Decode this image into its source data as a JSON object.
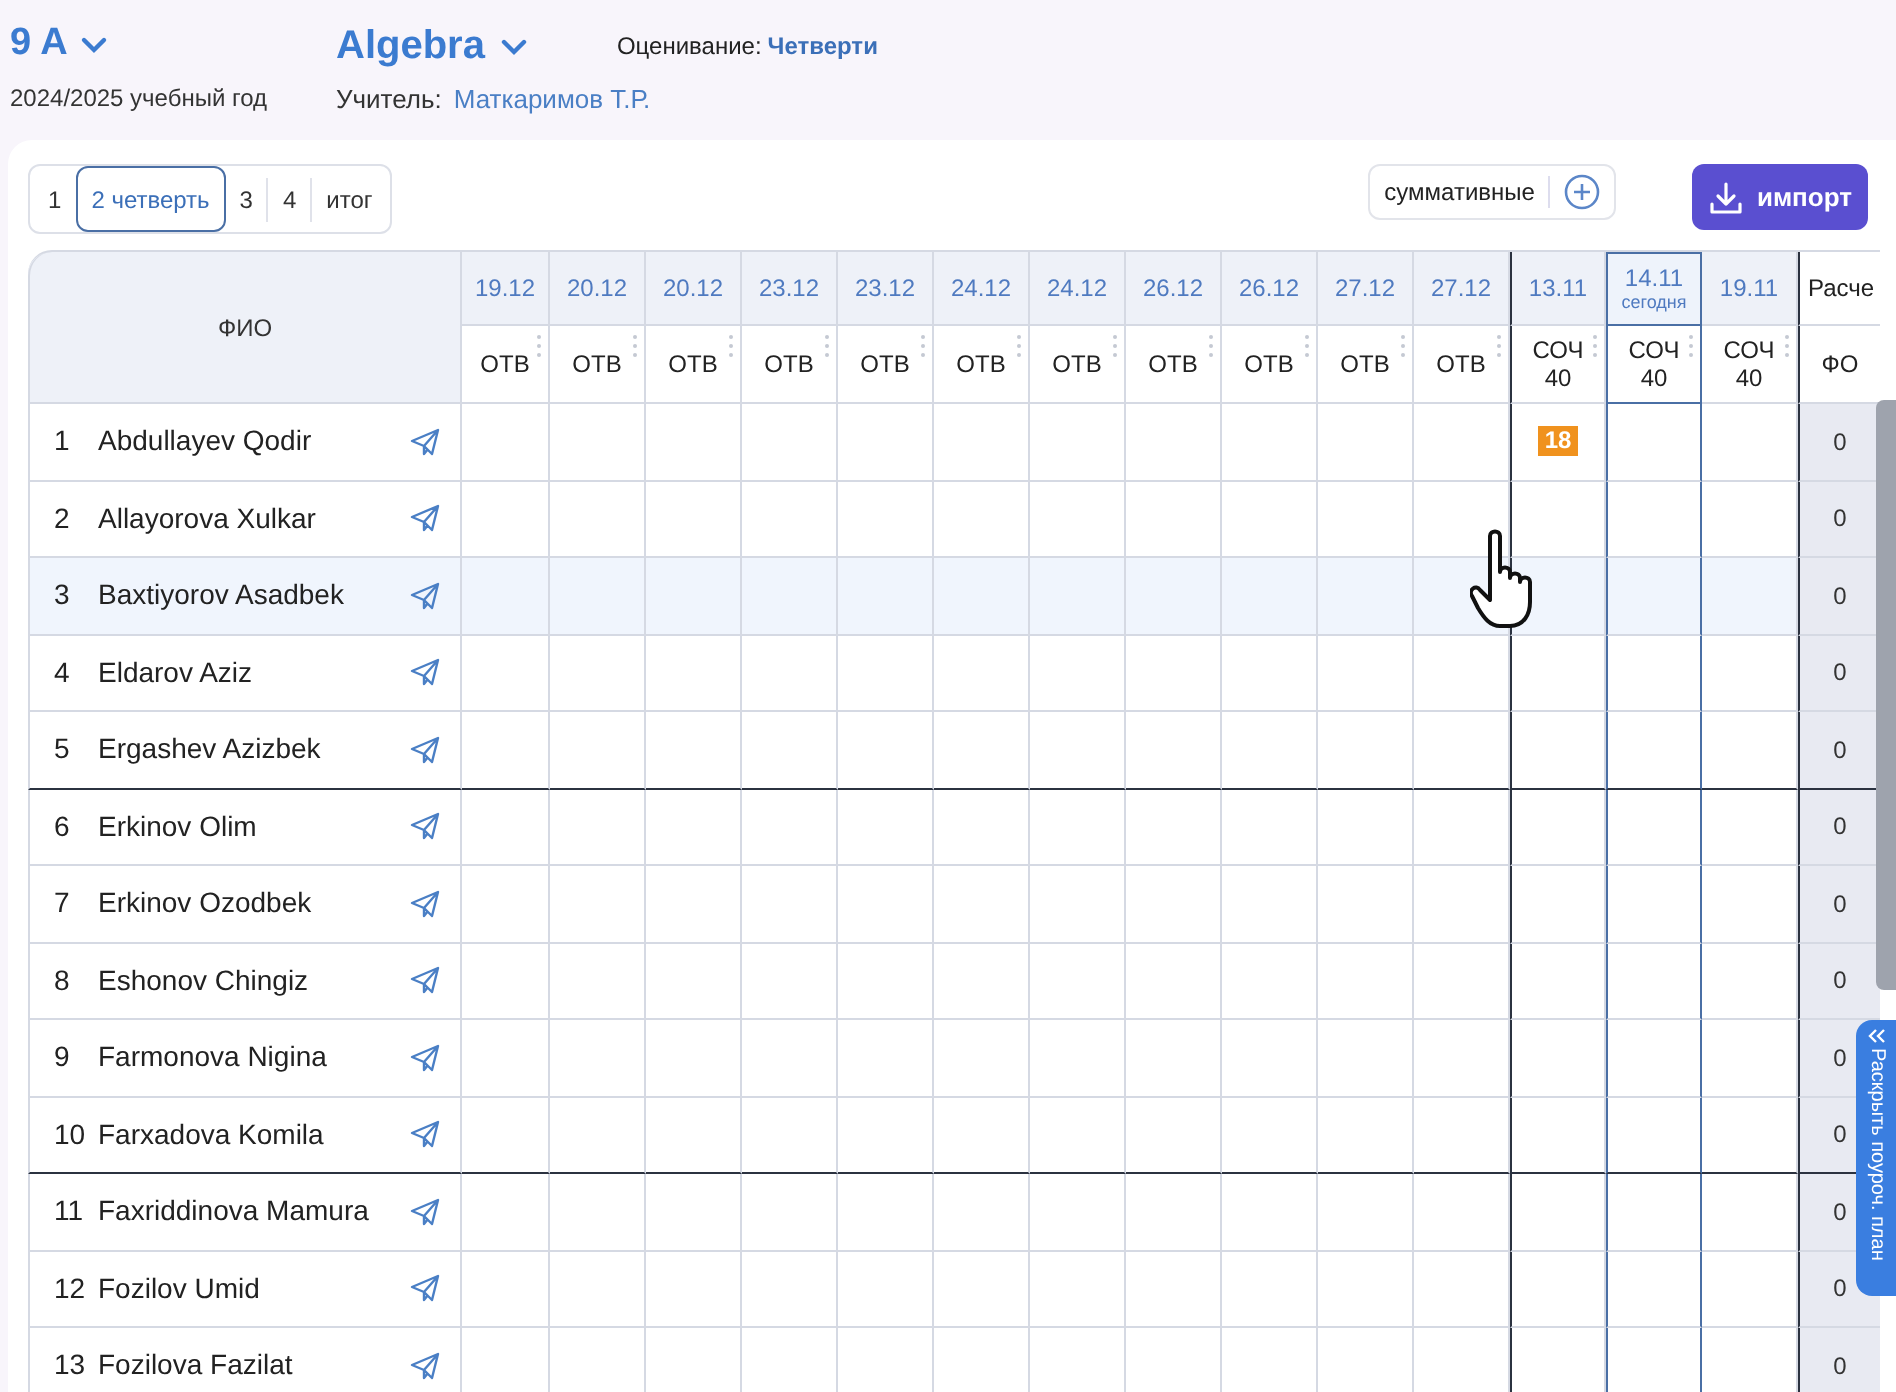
{
  "header": {
    "class_name": "9 A",
    "school_year": "2024/2025 учебный год",
    "subject": "Algebra",
    "grading_label": "Оценивание:",
    "grading_value": "Четверти",
    "teacher_label": "Учитель:",
    "teacher_name": "Маткаримов Т.Р."
  },
  "quarter_tabs": [
    {
      "label": "1",
      "selected": false
    },
    {
      "label": "2 четверть",
      "selected": true
    },
    {
      "label": "3",
      "selected": false
    },
    {
      "label": "4",
      "selected": false
    },
    {
      "label": "итог",
      "selected": false
    }
  ],
  "summative_button": "суммативные",
  "import_button": "импорт",
  "table": {
    "name_header": "ФИО",
    "columns": [
      {
        "date": "19.12",
        "type": "ОТВ",
        "kind": "current",
        "today": false
      },
      {
        "date": "20.12",
        "type": "ОТВ",
        "kind": "current",
        "today": false
      },
      {
        "date": "20.12",
        "type": "ОТВ",
        "kind": "current",
        "today": false
      },
      {
        "date": "23.12",
        "type": "ОТВ",
        "kind": "current",
        "today": false
      },
      {
        "date": "23.12",
        "type": "ОТВ",
        "kind": "current",
        "today": false
      },
      {
        "date": "24.12",
        "type": "ОТВ",
        "kind": "current",
        "today": false
      },
      {
        "date": "24.12",
        "type": "ОТВ",
        "kind": "current",
        "today": false
      },
      {
        "date": "26.12",
        "type": "ОТВ",
        "kind": "current",
        "today": false
      },
      {
        "date": "26.12",
        "type": "ОТВ",
        "kind": "current",
        "today": false
      },
      {
        "date": "27.12",
        "type": "ОТВ",
        "kind": "current",
        "today": false
      },
      {
        "date": "27.12",
        "type": "ОТВ",
        "kind": "current",
        "today": false
      },
      {
        "date": "13.11",
        "type": "СОЧ",
        "max": "40",
        "kind": "summative",
        "today": false
      },
      {
        "date": "14.11",
        "today_label": "сегодня",
        "type": "СОЧ",
        "max": "40",
        "kind": "summative",
        "today": true
      },
      {
        "date": "19.11",
        "type": "СОЧ",
        "max": "40",
        "kind": "summative",
        "today": false
      }
    ],
    "calc_header": "Расче",
    "calc_subheader": "ФО",
    "rows": [
      {
        "number": "1",
        "name": "Abdullayev Qodir",
        "cells": [
          null,
          null,
          null,
          null,
          null,
          null,
          null,
          null,
          null,
          null,
          null,
          "18",
          null,
          null
        ],
        "calc": "0",
        "hovered": false
      },
      {
        "number": "2",
        "name": "Allayorova Xulkar",
        "cells": [],
        "calc": "0",
        "hovered": false
      },
      {
        "number": "3",
        "name": "Baxtiyorov Asadbek",
        "cells": [],
        "calc": "0",
        "hovered": true
      },
      {
        "number": "4",
        "name": "Eldarov Aziz",
        "cells": [],
        "calc": "0",
        "hovered": false
      },
      {
        "number": "5",
        "name": "Ergashev Azizbek",
        "cells": [],
        "calc": "0",
        "hovered": false
      },
      {
        "number": "6",
        "name": "Erkinov Olim",
        "cells": [],
        "calc": "0",
        "hovered": false
      },
      {
        "number": "7",
        "name": "Erkinov Ozodbek",
        "cells": [],
        "calc": "0",
        "hovered": false
      },
      {
        "number": "8",
        "name": "Eshonov Chingiz",
        "cells": [],
        "calc": "0",
        "hovered": false
      },
      {
        "number": "9",
        "name": "Farmonova Nigina",
        "cells": [],
        "calc": "0",
        "hovered": false
      },
      {
        "number": "10",
        "name": "Farxadova Komila",
        "cells": [],
        "calc": "0",
        "hovered": false
      },
      {
        "number": "11",
        "name": "Faxriddinova Mamura",
        "cells": [],
        "calc": "0",
        "hovered": false
      },
      {
        "number": "12",
        "name": "Fozilov Umid",
        "cells": [],
        "calc": "0",
        "hovered": false
      },
      {
        "number": "13",
        "name": "Fozilova Fazilat",
        "cells": [],
        "calc": "0",
        "hovered": false
      }
    ]
  },
  "side_tab": "Раскрыть поуроч. план"
}
